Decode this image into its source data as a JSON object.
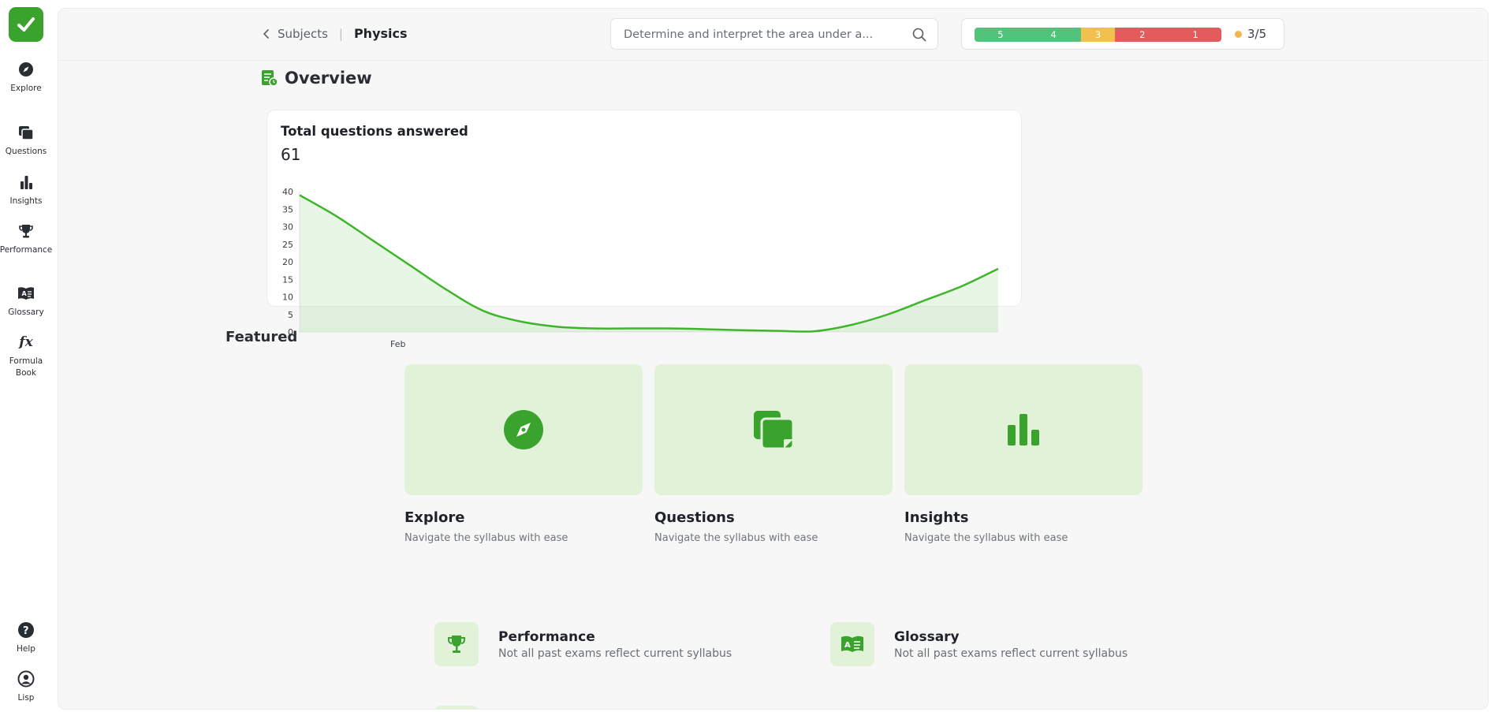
{
  "sidebar": {
    "logo": "check-logo",
    "items": [
      {
        "label": "Explore",
        "icon": "compass-icon"
      },
      {
        "label": "Questions",
        "icon": "cards-icon"
      },
      {
        "label": "Insights",
        "icon": "bar-chart-icon"
      },
      {
        "label": "Performance",
        "icon": "trophy-icon"
      },
      {
        "label": "Glossary",
        "icon": "book-icon"
      },
      {
        "label": "Formula\nBook",
        "icon": "fx-icon"
      }
    ],
    "bottom": [
      {
        "label": "Help",
        "icon": "help-icon"
      },
      {
        "label": "Lisp",
        "icon": "user-icon"
      }
    ]
  },
  "header": {
    "breadcrumb_parent": "Subjects",
    "breadcrumb_current": "Physics",
    "search_value": "Determine and interpret the area under a...",
    "grades": [
      {
        "label": "5",
        "color": "#52c37b",
        "share": 0.21
      },
      {
        "label": "4",
        "color": "#52c37b",
        "share": 0.22
      },
      {
        "label": "3",
        "color": "#f2c04c",
        "share": 0.14
      },
      {
        "label": "2",
        "color": "#e35b5b",
        "share": 0.22
      },
      {
        "label": "1",
        "color": "#e35b5b",
        "share": 0.21
      }
    ],
    "grade_score": "3/5"
  },
  "overview": {
    "title": "Overview",
    "card_title": "Total questions answered",
    "total": "61"
  },
  "chart_data": {
    "type": "area",
    "title": "Total questions answered",
    "xlabel": "",
    "ylabel": "",
    "ylim": [
      0,
      40
    ],
    "y_ticks": [
      "0",
      "5",
      "10",
      "15",
      "20",
      "25",
      "30",
      "35",
      "40"
    ],
    "x_tick_labels": [
      "Feb"
    ],
    "grid": false,
    "color": "#3fb52b",
    "series": [
      {
        "values": [
          39,
          33,
          26,
          19,
          12,
          6,
          3,
          1.5,
          1,
          1,
          1,
          0.8,
          0.5,
          0.3,
          0.2,
          2,
          5,
          9,
          13,
          18
        ]
      }
    ]
  },
  "featured": {
    "title": "Featured",
    "tiles": [
      {
        "title": "Explore",
        "subtitle": "Navigate the syllabus with ease",
        "icon": "compass-icon"
      },
      {
        "title": "Questions",
        "subtitle": "Navigate the syllabus with ease",
        "icon": "cards-icon"
      },
      {
        "title": "Insights",
        "subtitle": "Navigate the syllabus with ease",
        "icon": "bar-chart-icon"
      }
    ],
    "wide": [
      {
        "title": "Performance",
        "subtitle": "Not all past exams reflect current syllabus",
        "icon": "trophy-icon"
      },
      {
        "title": "Glossary",
        "subtitle": "Not all past exams reflect current syllabus",
        "icon": "book-icon"
      }
    ]
  }
}
